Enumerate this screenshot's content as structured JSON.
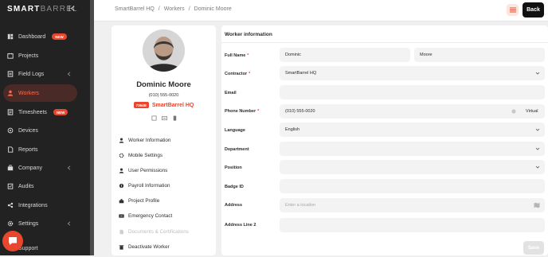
{
  "brand": {
    "logo_left": "SMART",
    "logo_right": "BARREL"
  },
  "sidebar": {
    "items": [
      {
        "label": "Dashboard",
        "badge": "NEW",
        "icon": "dashboard-icon"
      },
      {
        "label": "Projects",
        "icon": "projects-icon"
      },
      {
        "label": "Field Logs",
        "icon": "field-logs-icon"
      },
      {
        "label": "Workers",
        "icon": "worker-icon",
        "active": true
      },
      {
        "label": "Timesheets",
        "badge": "NEW",
        "icon": "timesheets-icon"
      },
      {
        "label": "Devices",
        "icon": "devices-icon"
      },
      {
        "label": "Reports",
        "icon": "reports-icon"
      },
      {
        "label": "Company",
        "icon": "company-icon"
      },
      {
        "label": "Audits",
        "icon": "audits-icon"
      },
      {
        "label": "Integrations",
        "icon": "integrations-icon"
      },
      {
        "label": "Settings",
        "icon": "settings-icon"
      },
      {
        "label": "Support",
        "icon": "support-icon"
      }
    ]
  },
  "topbar": {
    "breadcrumb": [
      "SmartBarrel HQ",
      "Workers",
      "Dominic Moore"
    ],
    "back_label": "Back"
  },
  "profile": {
    "name": "Dominic Moore",
    "phone": "(010) 555-0020",
    "company_badge": "7364B",
    "company": "SmartBarrel HQ",
    "menu": [
      {
        "label": "Worker Information",
        "icon": "person-icon"
      },
      {
        "label": "Mobile Settings",
        "icon": "mobile-settings-icon"
      },
      {
        "label": "User Permissions",
        "icon": "user-permissions-icon"
      },
      {
        "label": "Payroll Information",
        "icon": "payroll-icon"
      },
      {
        "label": "Project Profile",
        "icon": "project-profile-icon"
      },
      {
        "label": "Emergency Contact",
        "icon": "emergency-contact-icon"
      },
      {
        "label": "Documents & Certifications",
        "icon": "documents-icon",
        "disabled": true
      },
      {
        "label": "Deactivate Worker",
        "icon": "trash-icon"
      }
    ]
  },
  "form": {
    "title": "Worker information",
    "full_name_label": "Full Name",
    "first_name": "Dominic",
    "last_name": "Moore",
    "contractor_label": "Contractor",
    "contractor_value": "SmartBarrel HQ",
    "email_label": "Email",
    "email_value": "",
    "phone_label": "Phone Number",
    "phone_value": "(010) 555-0020",
    "phone_type": "Virtual",
    "language_label": "Language",
    "language_value": "English",
    "department_label": "Department",
    "department_value": "",
    "position_label": "Position",
    "position_value": "",
    "badge_id_label": "Badge ID",
    "badge_id_value": "",
    "address_label": "Address",
    "address_placeholder": "Enter a location",
    "address_line2_label": "Address Line 2",
    "address_line2_value": "",
    "required_mark": "*",
    "save_label": "Save"
  },
  "colors": {
    "accent": "#e9462e",
    "sidebar_bg": "#222222",
    "active_bg": "#4a2a26"
  }
}
